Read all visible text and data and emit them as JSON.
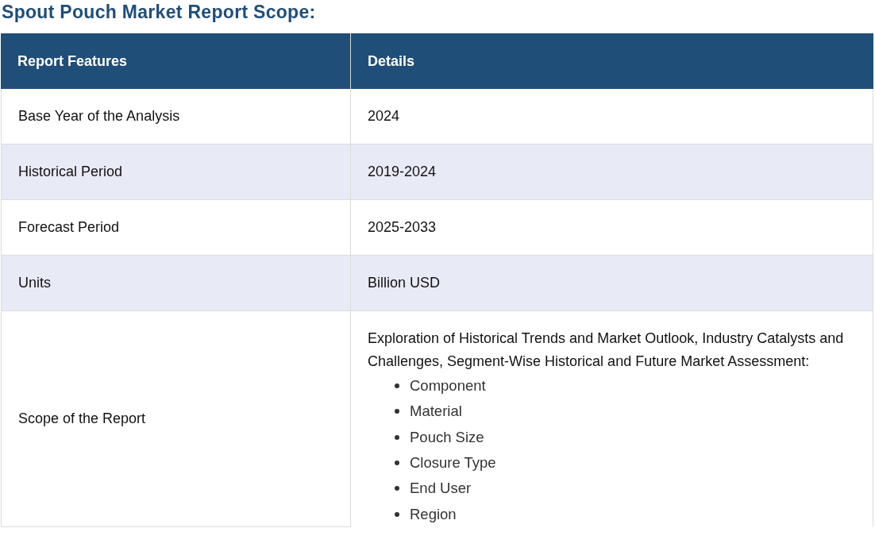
{
  "title": "Spout Pouch Market Report Scope:",
  "table": {
    "columns": [
      "Report Features",
      "Details"
    ],
    "rows": [
      {
        "feature": "Base Year of the Analysis",
        "details": "2024"
      },
      {
        "feature": "Historical Period",
        "details": "2019-2024"
      },
      {
        "feature": "Forecast Period",
        "details": "2025-2033"
      },
      {
        "feature": "Units",
        "details": "Billion USD"
      },
      {
        "feature": "Scope of the Report",
        "details": "Exploration of Historical Trends and Market Outlook, Industry Catalysts and Challenges, Segment-Wise Historical and Future Market Assessment:",
        "items": [
          "Component",
          "Material",
          "Pouch Size",
          "Closure Type",
          "End User",
          "Region"
        ]
      }
    ]
  }
}
